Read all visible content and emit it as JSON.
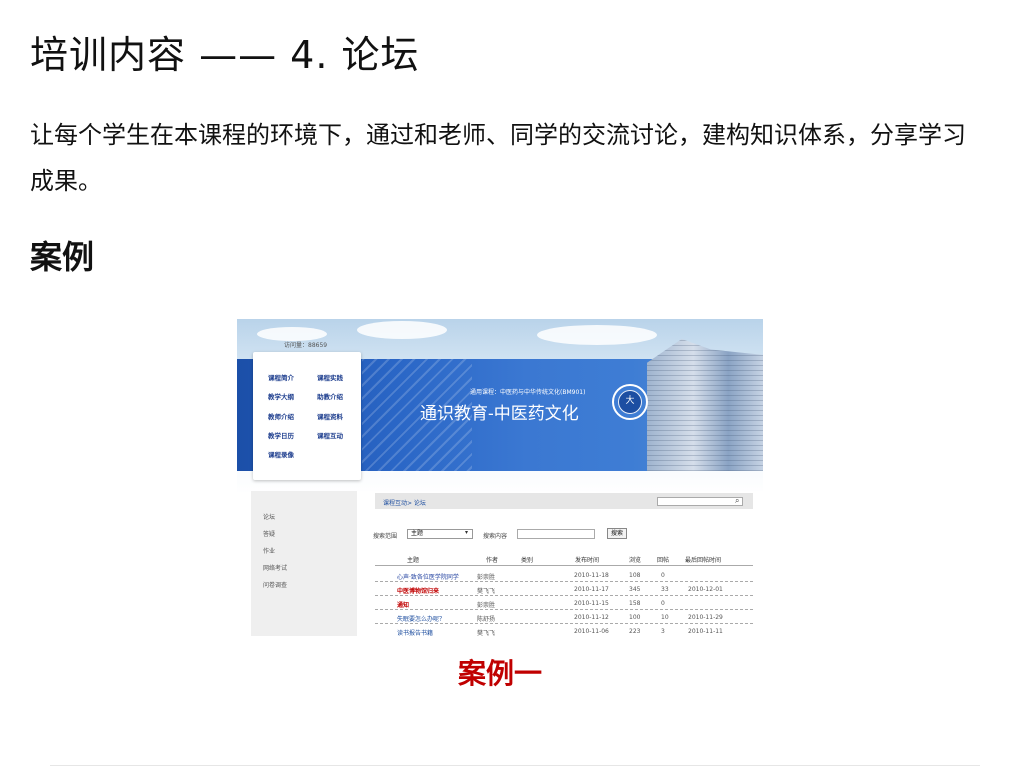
{
  "slide": {
    "title": "培训内容 —— 4. 论坛",
    "description": "让每个学生在本课程的环境下，通过和老师、同学的交流讨论，建构知识体系，分享学习成果。",
    "section_heading": "案例",
    "caption": "案例一"
  },
  "screenshot": {
    "visit_count": "访问量：88659",
    "nav_menu": [
      "课程简介",
      "课程实践",
      "教学大纲",
      "助教介绍",
      "教师介绍",
      "课程资料",
      "教学日历",
      "课程互动",
      "课程录像"
    ],
    "course_subtitle": "通用课程：中医药与中华传统文化(BM901)",
    "course_title": "通识教育-中医药文化",
    "emblem_text": "大",
    "sidebar_links": [
      "论坛",
      "答疑",
      "作业",
      "网络考试",
      "问卷调查"
    ],
    "breadcrumb": "课程互动> 论坛",
    "search_scope_label": "搜索范围",
    "search_scope_value": "主题",
    "search_content_label": "搜索内容",
    "search_button": "搜索",
    "columns": [
      "主题",
      "作者",
      "类别",
      "发布时间",
      "浏览",
      "回帖",
      "最后回帖时间"
    ],
    "rows": [
      [
        "心声·致各位医学院同学",
        "彭崇胜",
        "",
        "2010-11-18",
        "108",
        "0",
        ""
      ],
      [
        "中医博物馆归来",
        "樊飞飞",
        "",
        "2010-11-17",
        "345",
        "33",
        "2010-12-01"
      ],
      [
        "通知",
        "彭崇胜",
        "",
        "2010-11-15",
        "158",
        "0",
        ""
      ],
      [
        "失眠要怎么办呢？",
        "陈舒扬",
        "",
        "2010-11-12",
        "100",
        "10",
        "2010-11-29"
      ],
      [
        "读书报告书籍",
        "樊飞飞",
        "",
        "2010-11-06",
        "223",
        "3",
        "2010-11-11"
      ]
    ],
    "colors": {
      "banner_blue": "#2a66c6",
      "link_blue": "#1f4fa0",
      "alert_red": "#c00000"
    }
  }
}
